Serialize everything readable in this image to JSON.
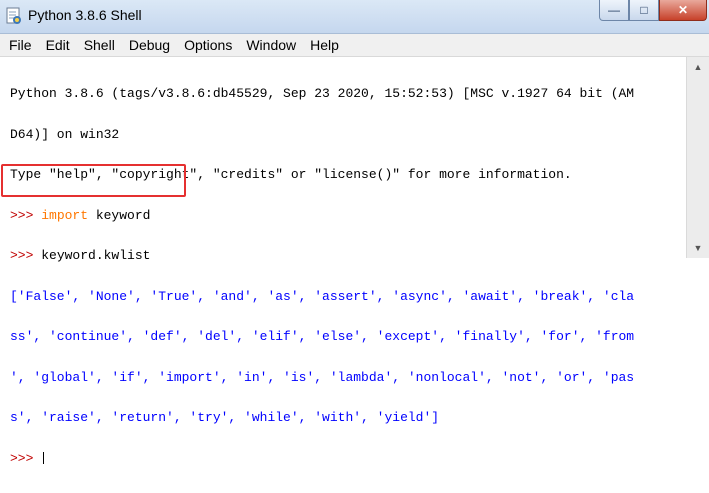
{
  "window": {
    "title": "Python 3.8.6 Shell",
    "icon": "python-idle-icon",
    "controls": {
      "minimize": "—",
      "maximize": "□",
      "close": "✕"
    }
  },
  "menu": [
    "File",
    "Edit",
    "Shell",
    "Debug",
    "Options",
    "Window",
    "Help"
  ],
  "shell": {
    "banner": [
      "Python 3.8.6 (tags/v3.8.6:db45529, Sep 23 2020, 15:52:53) [MSC v.1927 64 bit (AM",
      "D64)] on win32",
      "Type \"help\", \"copyright\", \"credits\" or \"license()\" for more information."
    ],
    "prompt": ">>> ",
    "cmd1_keyword": "import",
    "cmd1_rest": " keyword",
    "cmd2": "keyword.kwlist",
    "output": [
      "['False', 'None', 'True', 'and', 'as', 'assert', 'async', 'await', 'break', 'cla",
      "ss', 'continue', 'def', 'del', 'elif', 'else', 'except', 'finally', 'for', 'from",
      "', 'global', 'if', 'import', 'in', 'is', 'lambda', 'nonlocal', 'not', 'or', 'pas",
      "s', 'raise', 'return', 'try', 'while', 'with', 'yield']"
    ]
  },
  "colors": {
    "prompt": "#c00000",
    "keyword": "#ff7700",
    "output": "#0000ff",
    "annotation": "#e53030"
  }
}
